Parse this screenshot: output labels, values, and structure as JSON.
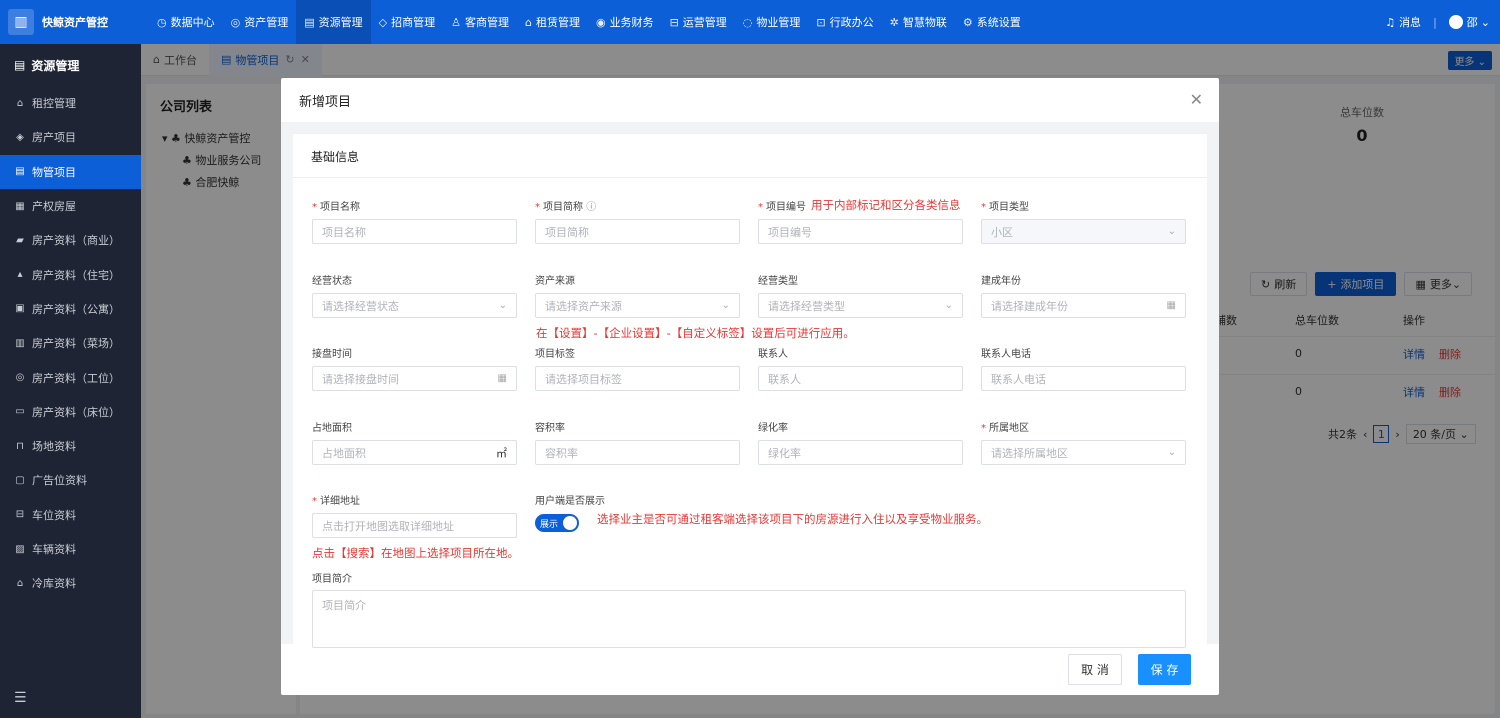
{
  "app": {
    "brand": "快鲸资产管控"
  },
  "nav": [
    "数据中心",
    "资产管理",
    "资源管理",
    "招商管理",
    "客商管理",
    "租赁管理",
    "业务财务",
    "运营管理",
    "物业管理",
    "行政办公",
    "智慧物联",
    "系统设置"
  ],
  "nav_icons": [
    "◷",
    "◎",
    "▤",
    "◇",
    "♙",
    "⌂",
    "◉",
    "⊟",
    "◌",
    "⊡",
    "✲",
    "⚙"
  ],
  "top_right": {
    "messages": "消息",
    "user": "邵"
  },
  "sidebar": {
    "title": "资源管理",
    "items": [
      "租控管理",
      "房产项目",
      "物管项目",
      "产权房屋",
      "房产资料（商业）",
      "房产资料（住宅）",
      "房产资料（公寓）",
      "房产资料（菜场）",
      "房产资料（工位）",
      "房产资料（床位）",
      "场地资料",
      "广告位资料",
      "车位资料",
      "车辆资料",
      "冷库资料"
    ]
  },
  "tabs": {
    "workbench": "工作台",
    "current": "物管项目"
  },
  "more_label": "更多",
  "background": {
    "company_list_title": "公司列表",
    "tree": [
      "快鲸资产管控",
      "物业服务公司",
      "合肥快鲸"
    ],
    "stat_label": "总车位数",
    "stat_value": "0",
    "refresh": "刷新",
    "add_project": "添加项目",
    "more": "更多",
    "col_shops": "铺数",
    "col_parking": "总车位数",
    "col_ops": "操作",
    "rows": [
      {
        "parking": "0",
        "detail": "详情",
        "delete": "删除"
      },
      {
        "parking": "0",
        "detail": "详情",
        "delete": "删除"
      }
    ],
    "pager_total": "共2条",
    "pager_page": "1",
    "pager_size": "20 条/页"
  },
  "modal": {
    "title": "新增项目",
    "section": "基础信息",
    "fields": {
      "name": {
        "label": "项目名称",
        "placeholder": "项目名称"
      },
      "short": {
        "label": "项目简称",
        "placeholder": "项目简称"
      },
      "code": {
        "label": "项目编号",
        "placeholder": "项目编号"
      },
      "type": {
        "label": "项目类型",
        "value": "小区"
      },
      "status": {
        "label": "经营状态",
        "placeholder": "请选择经营状态"
      },
      "source": {
        "label": "资产来源",
        "placeholder": "请选择资产来源"
      },
      "biz_type": {
        "label": "经营类型",
        "placeholder": "请选择经营类型"
      },
      "year": {
        "label": "建成年份",
        "placeholder": "请选择建成年份"
      },
      "takeover": {
        "label": "接盘时间",
        "placeholder": "请选择接盘时间"
      },
      "tags": {
        "label": "项目标签",
        "placeholder": "请选择项目标签"
      },
      "contact": {
        "label": "联系人",
        "placeholder": "联系人"
      },
      "phone": {
        "label": "联系人电话",
        "placeholder": "联系人电话"
      },
      "area": {
        "label": "占地面积",
        "placeholder": "占地面积",
        "unit": "㎡"
      },
      "far": {
        "label": "容积率",
        "placeholder": "容积率"
      },
      "green": {
        "label": "绿化率",
        "placeholder": "绿化率"
      },
      "region": {
        "label": "所属地区",
        "placeholder": "请选择所属地区"
      },
      "address": {
        "label": "详细地址",
        "placeholder": "点击打开地图选取详细地址"
      },
      "display": {
        "label": "用户端是否展示",
        "switch_text": "展示"
      },
      "intro": {
        "label": "项目简介",
        "placeholder": "项目简介"
      }
    },
    "hints": {
      "code": "用于内部标记和区分各类信息",
      "tags": "在【设置】-【企业设置】-【自定义标签】设置后可进行应用。",
      "display": "选择业主是否可通过租客端选择该项目下的房源进行入住以及享受物业服务。",
      "address": "点击【搜索】在地图上选择项目所在地。"
    },
    "cancel": "取 消",
    "save": "保 存"
  }
}
